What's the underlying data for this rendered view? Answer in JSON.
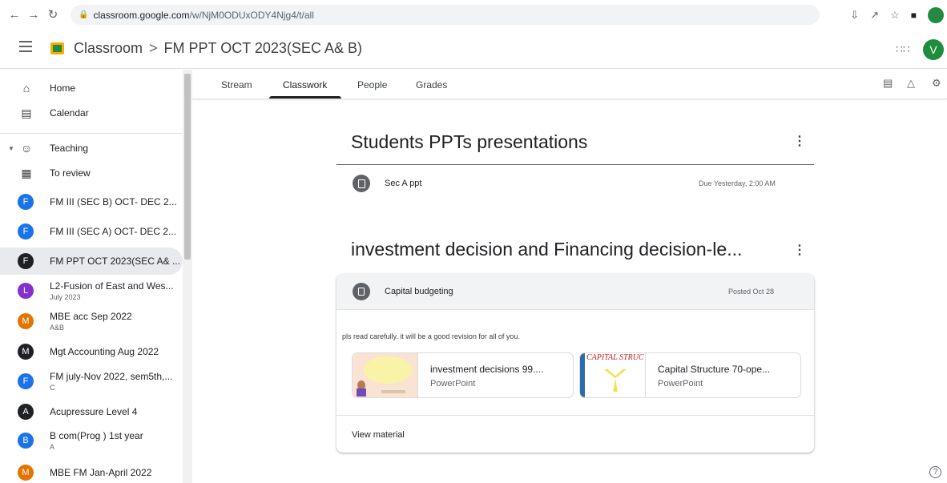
{
  "browser": {
    "url_host": "classroom.google.com",
    "url_path": "/w/NjM0ODUxODY4Njg4/t/all",
    "profile_initial": "V"
  },
  "header": {
    "app_name": "Classroom",
    "separator": ">",
    "class_name": "FM PPT OCT 2023(SEC A& B)",
    "avatar_initial": "V"
  },
  "sidebar": {
    "items": [
      {
        "label": "Home",
        "icon": "home-icon"
      },
      {
        "label": "Calendar",
        "icon": "calendar-icon"
      },
      {
        "label": "Teaching",
        "icon": "people-icon"
      },
      {
        "label": "To review",
        "icon": "review-icon"
      }
    ],
    "classes": [
      {
        "initial": "F",
        "label": "FM III (SEC B) OCT- DEC 2...",
        "sub": "",
        "color": "#1a73e8"
      },
      {
        "initial": "F",
        "label": "FM III (SEC A) OCT- DEC 2...",
        "sub": "",
        "color": "#1a73e8"
      },
      {
        "initial": "F",
        "label": "FM PPT OCT 2023(SEC A& ...",
        "sub": "",
        "color": "#202124"
      },
      {
        "initial": "L",
        "label": "L2-Fusion of East and Wes...",
        "sub": "July 2023",
        "color": "#8430ce"
      },
      {
        "initial": "M",
        "label": "MBE acc Sep 2022",
        "sub": "A&B",
        "color": "#e37400"
      },
      {
        "initial": "M",
        "label": "Mgt Accounting Aug 2022",
        "sub": "",
        "color": "#202124"
      },
      {
        "initial": "F",
        "label": "FM july-Nov 2022, sem5th,...",
        "sub": "C",
        "color": "#1a73e8"
      },
      {
        "initial": "A",
        "label": "Acupressure Level 4",
        "sub": "",
        "color": "#202124"
      },
      {
        "initial": "B",
        "label": "B com(Prog ) 1st year",
        "sub": "A",
        "color": "#1a73e8"
      },
      {
        "initial": "M",
        "label": "MBE FM Jan-April 2022",
        "sub": "",
        "color": "#e37400"
      }
    ]
  },
  "tabs": [
    {
      "label": "Stream"
    },
    {
      "label": "Classwork"
    },
    {
      "label": "People"
    },
    {
      "label": "Grades"
    }
  ],
  "topics": [
    {
      "title": "Students PPTs presentations",
      "item_title": "Sec A ppt",
      "item_meta": "Due Yesterday, 2:00 AM"
    },
    {
      "title": "investment decision and Financing decision-le...",
      "item_title": "Capital budgeting",
      "item_meta": "Posted Oct 28",
      "description": "pls read carefully. it will be a good revision for all of you.",
      "attachments": [
        {
          "title": "investment decisions 99....",
          "type": "PowerPoint"
        },
        {
          "title": "Capital Structure 70-ope...",
          "type": "PowerPoint",
          "thumb_text": "CAPITAL STRUC"
        }
      ],
      "view_label": "View material"
    }
  ]
}
